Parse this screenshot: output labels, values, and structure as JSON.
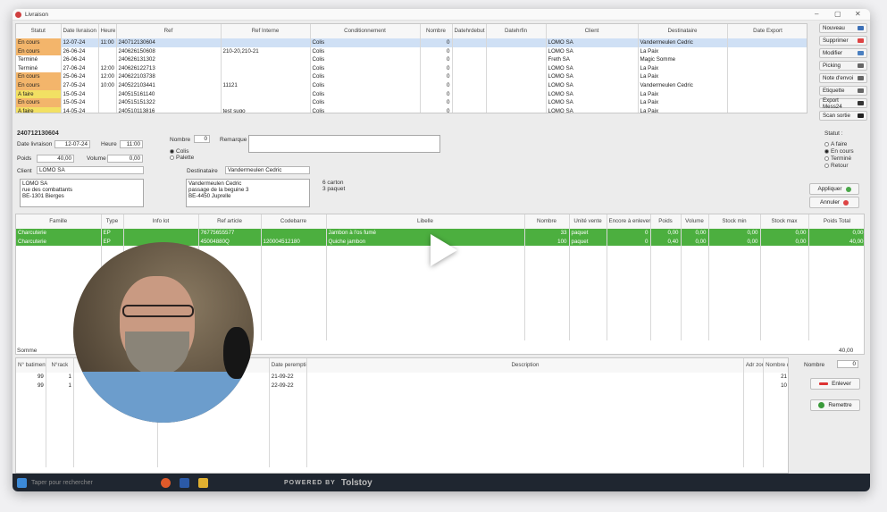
{
  "window": {
    "title": "Livraison",
    "min": "–",
    "max": "▢",
    "close": "✕"
  },
  "orders": {
    "headers": [
      "Statut",
      "Date livraison",
      "Heure",
      "Ref",
      "Ref Interne",
      "Conditionnement",
      "Nombre",
      "Datehrdebut",
      "Datehrfin",
      "Client",
      "Destinataire",
      "Date Export"
    ],
    "rows": [
      [
        "En cours",
        "12-07-24",
        "11:00",
        "240712130604",
        "",
        "Colis",
        "0",
        "",
        "",
        "LOMO SA",
        "Vandermeulen Cedric",
        ""
      ],
      [
        "En cours",
        "26-06-24",
        "",
        "240626150608",
        "210-20,210-21",
        "Colis",
        "0",
        "",
        "",
        "LOMO SA",
        "La Paix",
        ""
      ],
      [
        "Terminé",
        "26-06-24",
        "",
        "240626131302",
        "",
        "Colis",
        "0",
        "",
        "",
        "Freth SA",
        "Magic Somme",
        ""
      ],
      [
        "Terminé",
        "27-06-24",
        "12:00",
        "240626122713",
        "",
        "Colis",
        "0",
        "",
        "",
        "LOMO SA",
        "La Paix",
        ""
      ],
      [
        "En cours",
        "25-06-24",
        "12:00",
        "240622103738",
        "",
        "Colis",
        "0",
        "",
        "",
        "LOMO SA",
        "La Paix",
        ""
      ],
      [
        "En cours",
        "27-05-24",
        "10:00",
        "240522103441",
        "11121",
        "Colis",
        "0",
        "",
        "",
        "LOMO SA",
        "Vandermeulen Cedric",
        ""
      ],
      [
        "A faire",
        "15-05-24",
        "",
        "240515161140",
        "",
        "Colis",
        "0",
        "",
        "",
        "LOMO SA",
        "La Paix",
        ""
      ],
      [
        "En cours",
        "15-05-24",
        "",
        "240515151322",
        "",
        "Colis",
        "0",
        "",
        "",
        "LOMO SA",
        "La Paix",
        ""
      ],
      [
        "A faire",
        "14-05-24",
        "",
        "240510113816",
        "test sugo",
        "Colis",
        "0",
        "",
        "",
        "LOMO SA",
        "La Paix",
        ""
      ]
    ]
  },
  "actions": {
    "nouveau": "Nouveau",
    "supprimer": "Supprimer",
    "modifier": "Modifier",
    "picking": "Picking",
    "note": "Note d'envoi",
    "etiquette": "Etiquette",
    "export": "Export Mess24",
    "scan": "Scan sortie"
  },
  "detail": {
    "ref": "240712130604",
    "date_label": "Date livraison",
    "date": "12-07-24",
    "heure_label": "Heure",
    "heure": "11:00",
    "poids_label": "Poids",
    "poids": "40,00",
    "volume_label": "Volume",
    "volume": "0,00",
    "nombre_label": "Nombre",
    "nombre": "0",
    "remarque_label": "Remarque",
    "colis": "Colis",
    "palette": "Palette",
    "client_label": "Client",
    "client": "LOMO SA",
    "client_addr": "LOMO SA\nrue des combattants\nBE-1301 Bierges",
    "dest_label": "Destinataire",
    "dest": "Vandermeulen Cedric",
    "dest_addr": "Vandermeulen Cedric\npassage de la beguine 3\nBE-4450 Juprelle",
    "carton": "6 carton",
    "paquet": "3 paquet"
  },
  "statut": {
    "title": "Statut :",
    "opts": [
      "A faire",
      "En cours",
      "Terminé",
      "Retour"
    ]
  },
  "buttons": {
    "appliquer": "Appliquer",
    "annuler": "Annuler",
    "enlever": "Enlever",
    "remettre": "Remettre"
  },
  "articles": {
    "headers": [
      "Famille",
      "Type",
      "Info lot",
      "Ref article",
      "Codebarre",
      "Libelle",
      "Nombre",
      "Unité vente",
      "Encore à enlever",
      "Poids",
      "Volume",
      "Stock min",
      "Stock max",
      "Poids Total"
    ],
    "rows": [
      [
        "Charcuterie",
        "EP",
        "",
        "76775655577",
        "",
        "Jambon à l'os fumé",
        "33",
        "paquet",
        "0",
        "0,00",
        "0,00",
        "0,00",
        "0,00",
        "0,00"
      ],
      [
        "Charcuterie",
        "EP",
        "",
        "45004880Q",
        "120004512180",
        "Quiche jambon",
        "100",
        "paquet",
        "0",
        "0,40",
        "0,00",
        "0,00",
        "0,00",
        "40,00"
      ]
    ],
    "somme_label": "Somme",
    "somme": "40,00"
  },
  "lots": {
    "headers": [
      "N° batiment",
      "N°rack",
      "Niveau",
      "Order Number",
      "Date peremption",
      "Description",
      "Adr zone",
      "Nombre dispo"
    ],
    "rows": [
      [
        "99",
        "1",
        "1",
        "",
        "21-09-22",
        "",
        "",
        "21"
      ],
      [
        "99",
        "1",
        "1",
        "",
        "22-09-22",
        "",
        "",
        "10"
      ]
    ],
    "nombre_label": "Nombre",
    "nombre": "0"
  },
  "taskbar": {
    "search": "Taper pour rechercher",
    "powered": "POWERED BY",
    "brand": "Tolstoy"
  }
}
